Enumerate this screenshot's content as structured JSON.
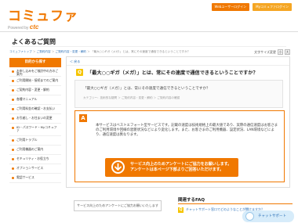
{
  "header": {
    "logo": "コミュファ",
    "logo_sub": "Powered by",
    "logo_brand": "ctc",
    "links": [
      "Webユーザーログイン",
      "Myコミュファログイン"
    ]
  },
  "page": {
    "title": "よくあるご質問",
    "font_size_label": "文字サイズ変更",
    "font_small": "小",
    "font_large": "大"
  },
  "breadcrumb": {
    "items": [
      "コミュファトップ",
      "ご契約内容",
      "ご契約内容・変更・解約",
      "「最大○○ギガ（メガ）」とは、常にその速度で通信できるということですか？"
    ]
  },
  "sidebar": {
    "heading": "目的から探す",
    "items": [
      "お申し込みをご検討中の方のご案内",
      "ご利用開始・接続までのご案内",
      "ご契約内容・変更・解約",
      "各種マニュアル",
      "ご利用料金の確認・お支払い",
      "お引越し・お住まいの変更",
      "ID・パスワード・Myコミュファ",
      "ご利用トラブル",
      "ご利用機器のご案内",
      "セキュリティ・お役立ち",
      "オプションサービス",
      "電話サービス"
    ]
  },
  "panel": {
    "back": "＜ 戻る",
    "question_badge": "Q",
    "question": "「最大○○ギガ（メガ）」とは、常にその速度で通信できるということですか？",
    "question_repeat": "「最大○○ギガ（メガ）」とは、常にその速度で通信できるということですか？",
    "category": "カテゴリー：技術的な疑問 ＞ ご契約内容・変更・解約 ＞ ご契約内容の確認",
    "answer_badge": "A",
    "answer": "本サービスはベストエフォート型サービスです。記載の速度は技術規格上の最大値であり、実際の通信速度はお客さまのご利用環境や回線の混雑状況などにより変化します。また、お客さまのご利用機器、設定状況、LAN環境などにより、通信速度は異なります。",
    "banner_line1": "サービス向上のためアンケートにご協力をお願いします。",
    "banner_line2": "アンケートは本ページ下部よりご回答いただけます。"
  },
  "survey": {
    "label": "サービス向上のためアンケートにご協力お願いいたします"
  },
  "faq": {
    "title": "関連するFAQ",
    "badge": "Q",
    "item": "チャットサポート窓口でどのようなことが聞けますか？"
  },
  "chatbot": {
    "label": "チャットサポート"
  }
}
